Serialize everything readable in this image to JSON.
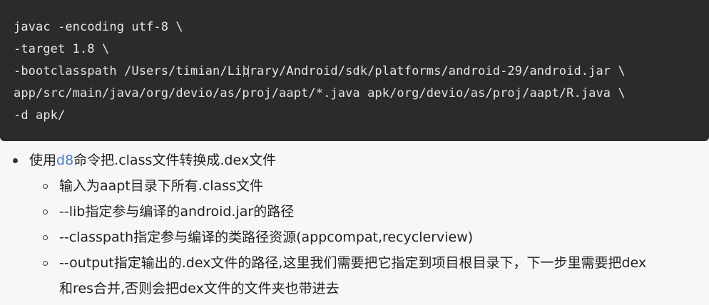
{
  "code": {
    "lines": [
      "javac -encoding utf-8 \\",
      "-target 1.8 \\",
      "-bootclasspath /Users/timian/Library/Android/sdk/platforms/android-29/android.jar \\",
      "app/src/main/java/org/devio/as/proj/aapt/*.java apk/org/devio/as/proj/aapt/R.java \\",
      "-d apk/"
    ]
  },
  "bullet": {
    "prefix": "使用",
    "link": "d8",
    "suffix": "命令把.class文件转换成.dex文件",
    "subitems": [
      "输入为aapt目录下所有.class文件",
      "--lib指定参与编译的android.jar的路径",
      "--classpath指定参与编译的类路径资源(appcompat,recyclerview)",
      "--output指定输出的.dex文件的路径,这里我们需要把它指定到项目根目录下，下一步里需要把dex",
      "和res合并,否则会把dex文件的文件夹也带进去"
    ]
  },
  "colors": {
    "code_background": "#2b2b2b",
    "code_text": "#e6e6e6",
    "link": "#4b7bc3"
  }
}
